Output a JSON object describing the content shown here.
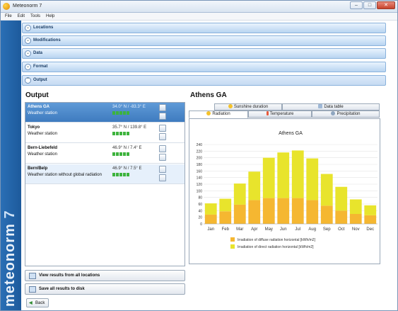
{
  "window": {
    "title": "Meteonorm 7",
    "minimize": "–",
    "maximize": "□",
    "close": "✕"
  },
  "menu": [
    "File",
    "Edit",
    "Tools",
    "Help"
  ],
  "brand": {
    "name": "meteonorm",
    "version": "7"
  },
  "sections": [
    "Locations",
    "Modifications",
    "Data",
    "Format",
    "Output"
  ],
  "output": {
    "title": "Output",
    "locations": [
      {
        "name": "Athens GA",
        "type": "Weather station",
        "coord": "34.0° N / -83.3° E",
        "quality": 5
      },
      {
        "name": "Tokyo",
        "type": "Weather station",
        "coord": "35.7° N / 139.8° E",
        "quality": 5
      },
      {
        "name": "Bern-Liebefeld",
        "type": "Weather station",
        "coord": "46.9° N / 7.4° E",
        "quality": 5
      },
      {
        "name": "Bern/Belp",
        "type": "Weather station without global radiation",
        "coord": "46.9° N / 7.5° E",
        "quality": 5
      }
    ],
    "view_all_label": "View results from all locations",
    "save_all_label": "Save all results to disk",
    "back_label": "Back"
  },
  "result": {
    "location": "Athens GA",
    "tabs_top": [
      "Sunshine duration",
      "Data table"
    ],
    "tabs_bottom": [
      "Radiation",
      "Temperature",
      "Precipitation"
    ]
  },
  "colors": {
    "diffuse": "#f5b731",
    "direct": "#e8e42c",
    "accent": "#3e7bbf"
  },
  "icons": {
    "sunshine": "sun-icon",
    "table": "table-icon",
    "radiation": "sun-icon",
    "temperature": "thermometer-icon",
    "precipitation": "cloud-icon"
  },
  "chart_data": {
    "type": "bar",
    "stacked": true,
    "title": "Athens GA",
    "categories": [
      "Jan",
      "Feb",
      "Mar",
      "Apr",
      "May",
      "Jun",
      "Jul",
      "Aug",
      "Sep",
      "Oct",
      "Nov",
      "Dec"
    ],
    "series": [
      {
        "name": "Irradiation of diffuse radiation horizontal [kWh/m2]",
        "values": [
          28,
          38,
          58,
          72,
          78,
          78,
          78,
          72,
          55,
          40,
          30,
          26
        ]
      },
      {
        "name": "Irradiation of direct radiation horizontal [kWh/m2]",
        "values": [
          34,
          38,
          64,
          86,
          122,
          138,
          144,
          126,
          96,
          72,
          44,
          30
        ]
      }
    ],
    "yticks": [
      0,
      20,
      40,
      60,
      80,
      100,
      120,
      140,
      160,
      180,
      200,
      220,
      240
    ],
    "ylim": [
      0,
      240
    ],
    "grid": true,
    "legend": "bottom"
  }
}
